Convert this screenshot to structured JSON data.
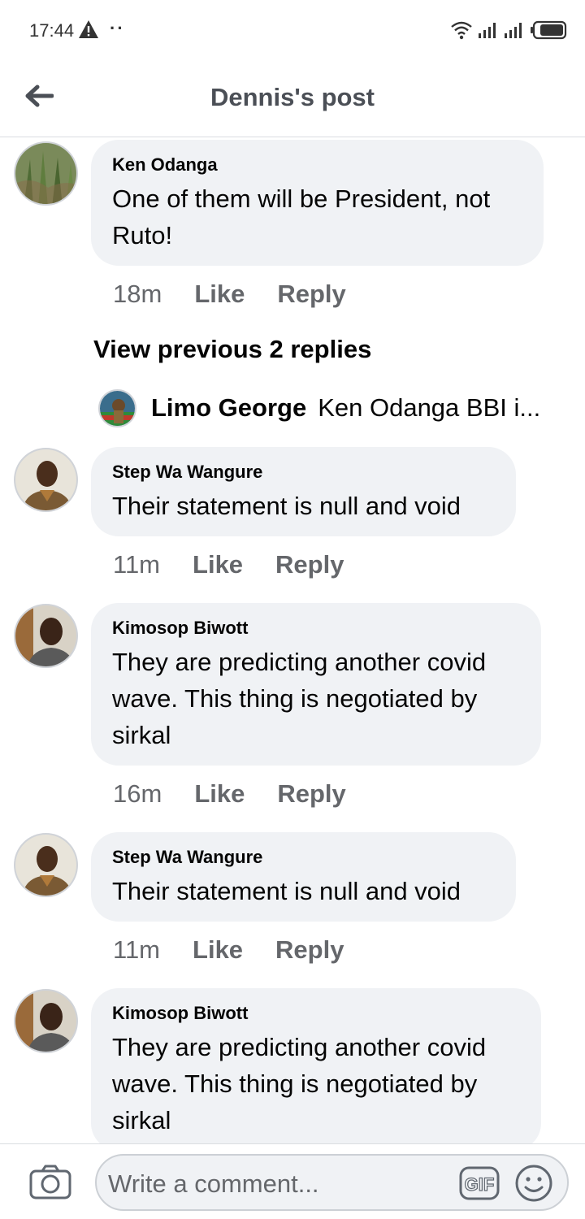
{
  "status_bar": {
    "time": "17:44",
    "icons": [
      "warning-icon",
      "more-dots-icon",
      "wifi-icon",
      "signal-icon",
      "signal-icon",
      "battery-icon"
    ]
  },
  "header": {
    "title": "Dennis's post",
    "back_icon": "arrow-left-icon"
  },
  "comments": [
    {
      "author": "Ken Odanga",
      "text": "One of them will be President, not Ruto!",
      "time": "18m",
      "like": "Like",
      "reply": "Reply"
    },
    {
      "author": "Step Wa Wangure",
      "text": "Their statement is null and void",
      "time": "11m",
      "like": "Like",
      "reply": "Reply"
    },
    {
      "author": "Kimosop Biwott",
      "text": "They are predicting another covid wave. This thing is negotiated by sirkal",
      "time": "16m",
      "like": "Like",
      "reply": "Reply"
    },
    {
      "author": "Step Wa Wangure",
      "text": "Their statement is null and void",
      "time": "11m",
      "like": "Like",
      "reply": "Reply"
    },
    {
      "author": "Kimosop Biwott",
      "text": "They are predicting another covid wave. This thing is negotiated by sirkal"
    }
  ],
  "view_previous": "View previous 2 replies",
  "reply_preview": {
    "author": "Limo George",
    "text": "Ken Odanga BBI i..."
  },
  "composer": {
    "placeholder": "Write a comment...",
    "gif_label": "GIF",
    "icons": [
      "camera-icon",
      "gif-icon",
      "emoji-icon"
    ]
  },
  "colors": {
    "bubble": "#f0f2f5",
    "secondary_text": "#65676b",
    "primary_text": "#050505"
  }
}
